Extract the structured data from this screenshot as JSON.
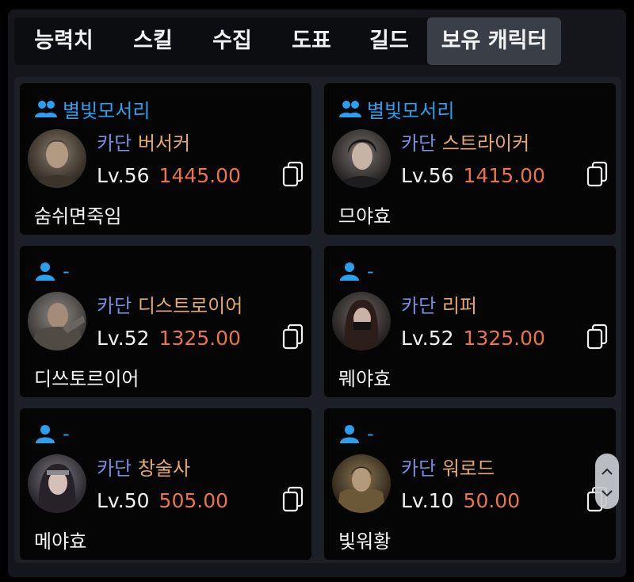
{
  "tabs": [
    {
      "label": "능력치",
      "active": false
    },
    {
      "label": "스킬",
      "active": false
    },
    {
      "label": "수집",
      "active": false
    },
    {
      "label": "도표",
      "active": false
    },
    {
      "label": "길드",
      "active": false
    },
    {
      "label": "보유 캐릭터",
      "active": true
    }
  ],
  "characters": [
    {
      "guild": "별빛모서리",
      "guild_icon": "people-icon",
      "server": "카단",
      "class": "버서커",
      "level": "Lv.56",
      "item_level": "1445.00",
      "name": "숨쉬면죽임"
    },
    {
      "guild": "별빛모서리",
      "guild_icon": "people-icon",
      "server": "카단",
      "class": "스트라이커",
      "level": "Lv.56",
      "item_level": "1415.00",
      "name": "므야효"
    },
    {
      "guild": "-",
      "guild_icon": "person-icon",
      "server": "카단",
      "class": "디스트로이어",
      "level": "Lv.52",
      "item_level": "1325.00",
      "name": "디쓰토르이어"
    },
    {
      "guild": "-",
      "guild_icon": "person-icon",
      "server": "카단",
      "class": "리퍼",
      "level": "Lv.52",
      "item_level": "1325.00",
      "name": "뭬야효"
    },
    {
      "guild": "-",
      "guild_icon": "person-icon",
      "server": "카단",
      "class": "창술사",
      "level": "Lv.50",
      "item_level": "505.00",
      "name": "메야효"
    },
    {
      "guild": "-",
      "guild_icon": "person-icon",
      "server": "카단",
      "class": "워로드",
      "level": "Lv.10",
      "item_level": "50.00",
      "name": "빛워황"
    }
  ],
  "colors": {
    "guild": "#2aa0ef",
    "server": "#7c8ddf",
    "class": "#e2a96b",
    "item_level": "#e8734e",
    "active_tab": "#3a3e47"
  },
  "scroll_controls": {
    "up_icon": "chevron-up-icon",
    "down_icon": "chevron-down-icon"
  }
}
